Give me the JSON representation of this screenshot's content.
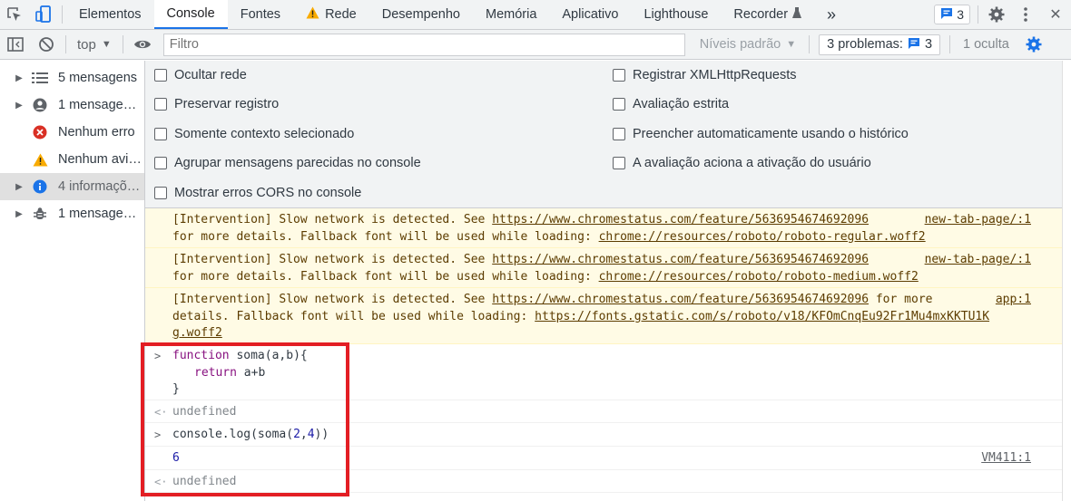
{
  "tabs": {
    "items": [
      "Elementos",
      "Console",
      "Fontes",
      "Rede",
      "Desempenho",
      "Memória",
      "Aplicativo",
      "Lighthouse",
      "Recorder"
    ],
    "more": "»",
    "issues_count": "3",
    "close": "✕"
  },
  "toolbar": {
    "context": "top",
    "filter_placeholder": "Filtro",
    "levels": "Níveis padrão",
    "problems_label": "3 problemas:",
    "problems_count": "3",
    "hidden": "1 oculta"
  },
  "sidebar": {
    "items": [
      {
        "label": "5 mensagens"
      },
      {
        "label": "1 mensage…"
      },
      {
        "label": "Nenhum erro"
      },
      {
        "label": "Nenhum avi…"
      },
      {
        "label": "4 informaçõ…"
      },
      {
        "label": "1 mensage…"
      }
    ]
  },
  "settings": {
    "left": [
      "Ocultar rede",
      "Preservar registro",
      "Somente contexto selecionado",
      "Agrupar mensagens parecidas no console",
      "Mostrar erros CORS no console"
    ],
    "right": [
      "Registrar XMLHttpRequests",
      "Avaliação estrita",
      "Preencher automaticamente usando o histórico",
      "A avaliação aciona a ativação do usuário"
    ]
  },
  "messages": {
    "w1_a": "[Intervention] Slow network is detected. See ",
    "w1_link": "https://www.chromestatus.com/feature/5636954674692096",
    "w1_src": "new-tab-page/:1",
    "w1_b": "for more details. Fallback font will be used while loading: ",
    "w1_font": "chrome://resources/roboto/roboto-regular.woff2",
    "w2_a": "[Intervention] Slow network is detected. See ",
    "w2_link": "https://www.chromestatus.com/feature/5636954674692096",
    "w2_src": "new-tab-page/:1",
    "w2_b": "for more details. Fallback font will be used while loading: ",
    "w2_font": "chrome://resources/roboto/roboto-medium.woff2",
    "w3_a": "[Intervention] Slow network is detected. See ",
    "w3_link": "https://www.chromestatus.com/feature/5636954674692096",
    "w3_tail": " for more",
    "w3_src": "app:1",
    "w3_b": "details. Fallback font will be used while loading: ",
    "w3_font1": "https://fonts.gstatic.com/s/roboto/v18/KFOmCnqEu92Fr1Mu4mxKKTU1K",
    "w3_font2": "g.woff2"
  },
  "code": {
    "kw_function": "function",
    "fn_sig": " soma(a,b){",
    "kw_return": "return",
    "ret_expr": " a+b",
    "close": "}",
    "undefined1": "undefined",
    "call": "console.log(soma(2,4))",
    "output": "6",
    "output_src": "VM411:1",
    "undefined2": "undefined"
  }
}
